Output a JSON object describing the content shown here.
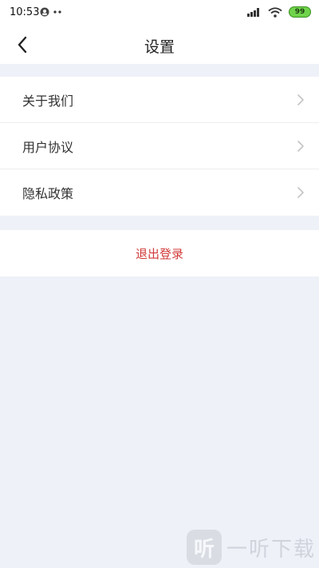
{
  "status_bar": {
    "time": "10:53",
    "battery": "99"
  },
  "nav": {
    "title": "设置"
  },
  "menu": {
    "items": [
      {
        "label": "关于我们"
      },
      {
        "label": "用户协议"
      },
      {
        "label": "隐私政策"
      }
    ]
  },
  "logout": {
    "label": "退出登录"
  },
  "watermark": {
    "logo_char": "听",
    "text": "一听下载"
  },
  "colors": {
    "background": "#eef1f8",
    "logout_text": "#d23a3a",
    "battery_fill": "#6fd44a"
  }
}
